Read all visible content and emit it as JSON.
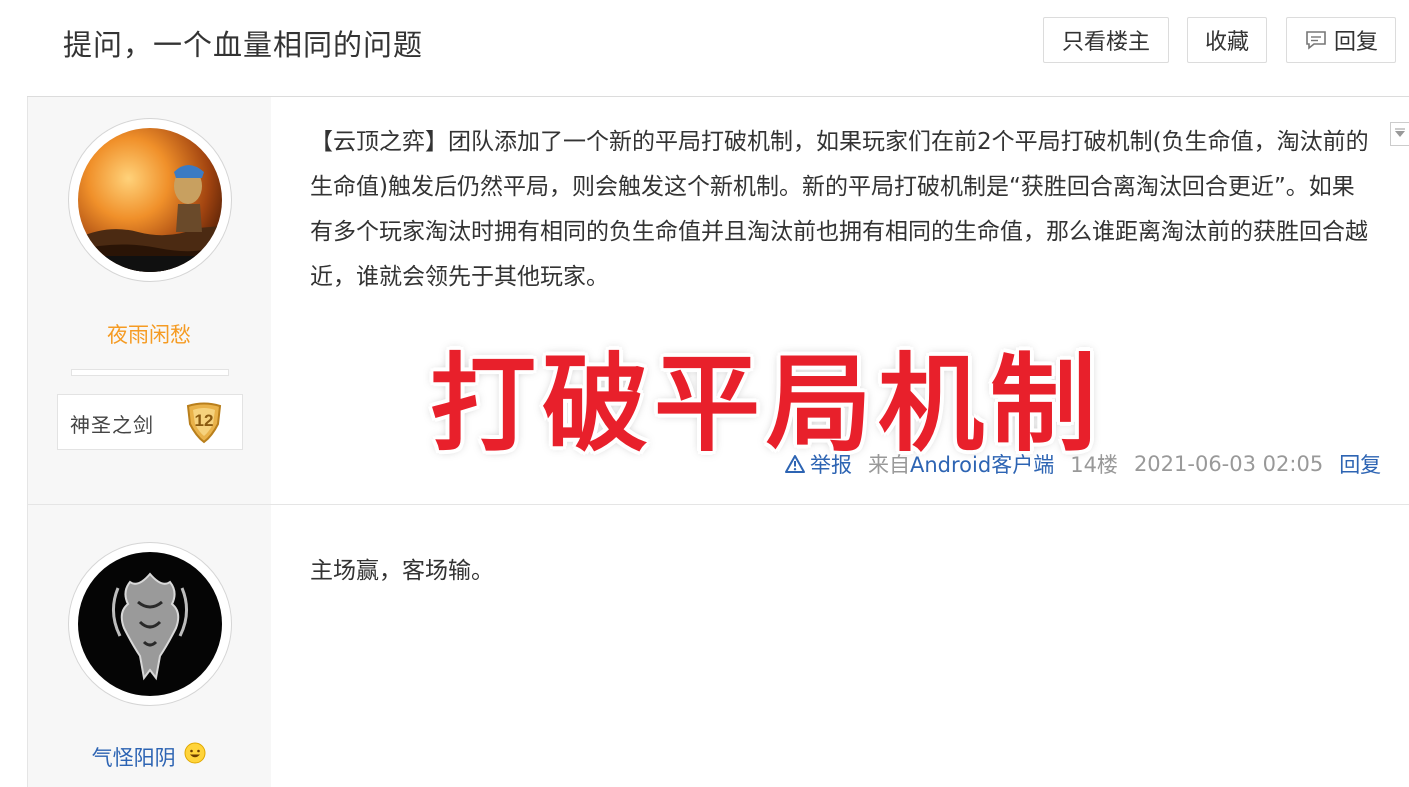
{
  "header": {
    "title": "提问，一个血量相同的问题",
    "buttons": {
      "only_op": "只看楼主",
      "favorite": "收藏",
      "reply": "回复"
    }
  },
  "posts": [
    {
      "user": {
        "name": "夜雨闲愁",
        "name_color": "#f59b23",
        "badge_name": "神圣之剑",
        "badge_level": "12"
      },
      "content": "【云顶之弈】团队添加了一个新的平局打破机制，如果玩家们在前2个平局打破机制(负生命值，淘汰前的生命值)触发后仍然平局，则会触发这个新机制。新的平局打破机制是“获胜回合离淘汰回合更近”。如果有多个玩家淘汰时拥有相同的负生命值并且淘汰前也拥有相同的生命值，那么谁距离淘汰前的获胜回合越近，谁就会领先于其他玩家。",
      "overlay_text": "打破平局机制",
      "meta": {
        "report": "举报",
        "source_prefix": "来自",
        "source_client": "Android客户端",
        "floor": "14楼",
        "time": "2021-06-03 02:05",
        "reply": "回复"
      }
    },
    {
      "user": {
        "name": "气怪阳阴",
        "name_color": "#2d64b3"
      },
      "content": "主场赢，客场输。"
    }
  ],
  "colors": {
    "accent_link": "#2d64b3",
    "overlay_red": "#e8202b",
    "username_orange": "#f59b23"
  }
}
